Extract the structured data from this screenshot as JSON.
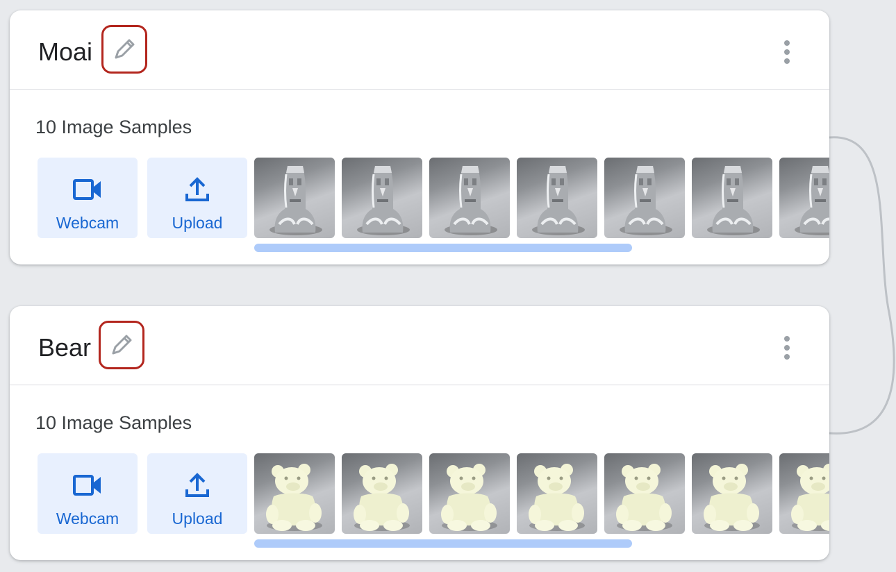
{
  "cards": [
    {
      "name": "Moai",
      "samples_label": "10 Image Samples",
      "webcam_label": "Webcam",
      "upload_label": "Upload",
      "thumbnail_subject": "moai-statue",
      "visible_thumbnails": 7
    },
    {
      "name": "Bear",
      "samples_label": "10 Image Samples",
      "webcam_label": "Webcam",
      "upload_label": "Upload",
      "thumbnail_subject": "bear-figurine",
      "visible_thumbnails": 7
    }
  ],
  "icons": {
    "edit": "pencil-icon",
    "menu": "more-vert-icon",
    "webcam": "videocam-icon",
    "upload": "upload-icon"
  },
  "colors": {
    "background": "#e8eaed",
    "card": "#ffffff",
    "accent": "#1967d2",
    "button_bg": "#e8f0fe",
    "highlight": "#b3261e",
    "scrollbar": "#aecbfa",
    "text": "#202124"
  }
}
